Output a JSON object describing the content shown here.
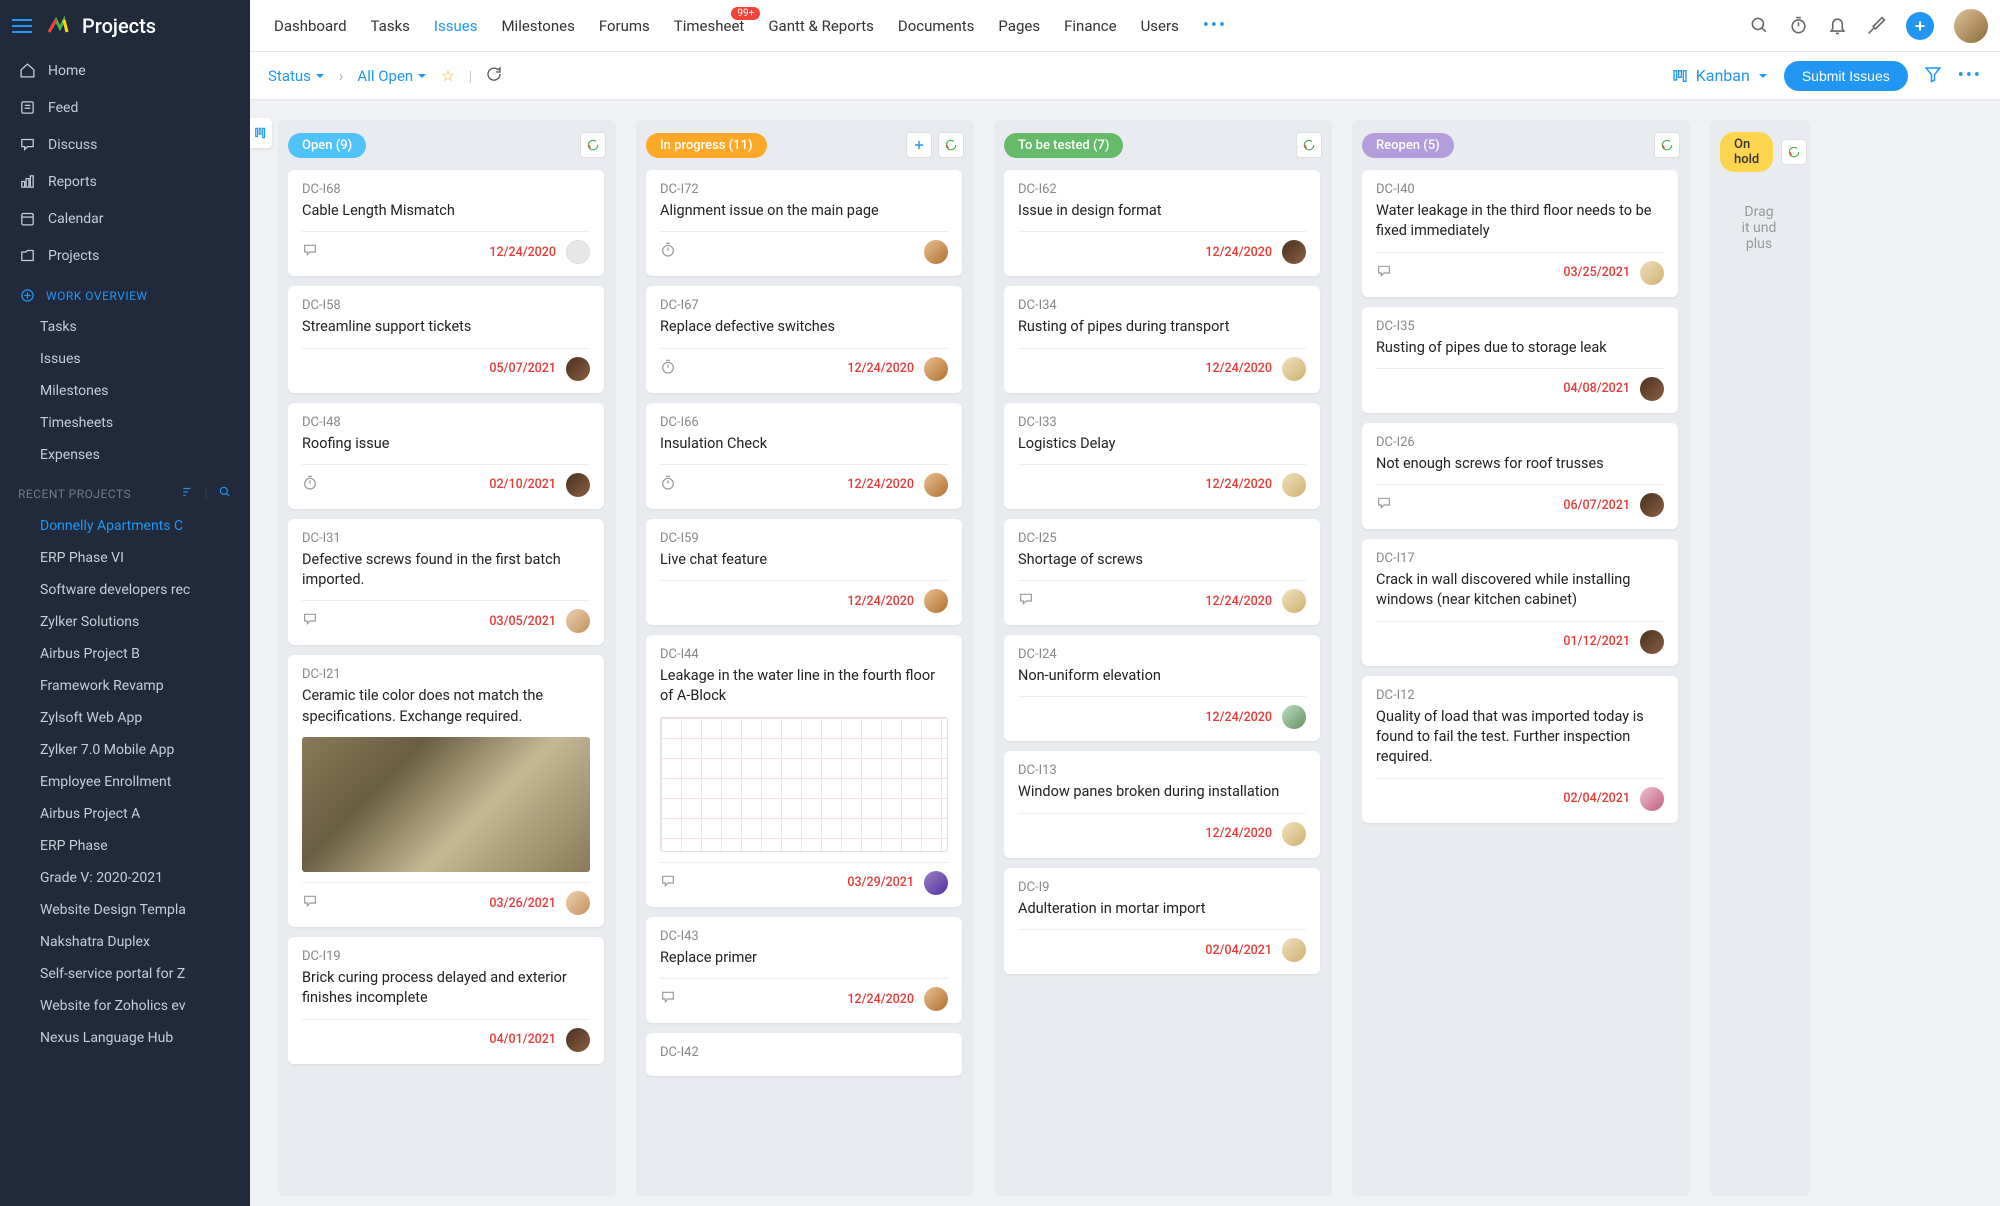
{
  "brand": "Projects",
  "topnav": [
    "Dashboard",
    "Tasks",
    "Issues",
    "Milestones",
    "Forums",
    "Timesheet",
    "Gantt & Reports",
    "Documents",
    "Pages",
    "Finance",
    "Users"
  ],
  "topnav_active_index": 2,
  "timesheet_badge": "99+",
  "sidebar": {
    "main": [
      "Home",
      "Feed",
      "Discuss",
      "Reports",
      "Calendar",
      "Projects"
    ],
    "overview_label": "WORK OVERVIEW",
    "overview": [
      "Tasks",
      "Issues",
      "Milestones",
      "Timesheets",
      "Expenses"
    ],
    "recent_label": "RECENT PROJECTS",
    "recent": [
      "Donnelly Apartments C",
      "ERP Phase VI",
      "Software developers rec",
      "Zylker Solutions",
      "Airbus Project B",
      "Framework Revamp",
      "Zylsoft Web App",
      "Zylker 7.0 Mobile App",
      "Employee Enrollment",
      "Airbus Project A",
      "ERP Phase",
      "Grade V: 2020-2021",
      "Website Design Templa",
      "Nakshatra Duplex",
      "Self-service portal for Z",
      "Website for Zoholics ev",
      "Nexus Language Hub"
    ],
    "recent_active_index": 0
  },
  "subheader": {
    "status": "Status",
    "all_open": "All Open",
    "kanban": "Kanban",
    "submit": "Submit Issues"
  },
  "columns": [
    {
      "label": "Open (9)",
      "pill_class": "pill-open",
      "show_plus": false,
      "cards": [
        {
          "code": "DC-I68",
          "title": "Cable Length Mismatch",
          "date": "12/24/2020",
          "icon": "comment",
          "avatar": "av-empty"
        },
        {
          "code": "DC-I58",
          "title": "Streamline support tickets",
          "date": "05/07/2021",
          "icon": "",
          "avatar": "av1"
        },
        {
          "code": "DC-I48",
          "title": "Roofing issue",
          "date": "02/10/2021",
          "icon": "clock",
          "avatar": "av1"
        },
        {
          "code": "DC-I31",
          "title": "Defective screws found in the first batch imported.",
          "date": "03/05/2021",
          "icon": "comment",
          "avatar": "av2"
        },
        {
          "code": "DC-I21",
          "title": "Ceramic tile color does not match the specifications. Exchange required.",
          "date": "03/26/2021",
          "icon": "comment",
          "avatar": "av2",
          "image": "tile"
        },
        {
          "code": "DC-I19",
          "title": "Brick curing process delayed and exterior finishes incomplete",
          "date": "04/01/2021",
          "icon": "",
          "avatar": "av1"
        }
      ]
    },
    {
      "label": "In progress (11)",
      "pill_class": "pill-inprogress",
      "show_plus": true,
      "cards": [
        {
          "code": "DC-I72",
          "title": "Alignment issue on the main page",
          "date": "",
          "icon": "clock",
          "avatar": "av3"
        },
        {
          "code": "DC-I67",
          "title": "Replace defective switches",
          "date": "12/24/2020",
          "icon": "clock",
          "avatar": "av3"
        },
        {
          "code": "DC-I66",
          "title": "Insulation Check",
          "date": "12/24/2020",
          "icon": "clock",
          "avatar": "av3"
        },
        {
          "code": "DC-I59",
          "title": "Live chat feature",
          "date": "12/24/2020",
          "icon": "",
          "avatar": "av3"
        },
        {
          "code": "DC-I44",
          "title": "Leakage in the water line in the fourth floor of A-Block",
          "date": "03/29/2021",
          "icon": "comment",
          "avatar": "av4",
          "image": "floorplan"
        },
        {
          "code": "DC-I43",
          "title": "Replace primer",
          "date": "12/24/2020",
          "icon": "comment",
          "avatar": "av3"
        },
        {
          "code": "DC-I42",
          "title": "",
          "date": "",
          "icon": "",
          "avatar": ""
        }
      ]
    },
    {
      "label": "To be tested (7)",
      "pill_class": "pill-tobetested",
      "show_plus": false,
      "cards": [
        {
          "code": "DC-I62",
          "title": "Issue in design format",
          "date": "12/24/2020",
          "icon": "",
          "avatar": "av1"
        },
        {
          "code": "DC-I34",
          "title": "Rusting of pipes during transport",
          "date": "12/24/2020",
          "icon": "",
          "avatar": "av5"
        },
        {
          "code": "DC-I33",
          "title": "Logistics Delay",
          "date": "12/24/2020",
          "icon": "",
          "avatar": "av5"
        },
        {
          "code": "DC-I25",
          "title": "Shortage of screws",
          "date": "12/24/2020",
          "icon": "comment",
          "avatar": "av5"
        },
        {
          "code": "DC-I24",
          "title": "Non-uniform elevation",
          "date": "12/24/2020",
          "icon": "",
          "avatar": "av6"
        },
        {
          "code": "DC-I13",
          "title": "Window panes broken during installation",
          "date": "12/24/2020",
          "icon": "",
          "avatar": "av5"
        },
        {
          "code": "DC-I9",
          "title": "Adulteration in mortar import",
          "date": "02/04/2021",
          "icon": "",
          "avatar": "av5"
        }
      ]
    },
    {
      "label": "Reopen (5)",
      "pill_class": "pill-reopen",
      "show_plus": false,
      "cards": [
        {
          "code": "DC-I40",
          "title": "Water leakage in the third floor needs to be fixed immediately",
          "date": "03/25/2021",
          "icon": "comment",
          "avatar": "av5"
        },
        {
          "code": "DC-I35",
          "title": "Rusting of pipes due to storage leak",
          "date": "04/08/2021",
          "icon": "",
          "avatar": "av1"
        },
        {
          "code": "DC-I26",
          "title": "Not enough screws for roof trusses",
          "date": "06/07/2021",
          "icon": "comment",
          "avatar": "av1"
        },
        {
          "code": "DC-I17",
          "title": "Crack in wall discovered while installing windows (near kitchen cabinet)",
          "date": "01/12/2021",
          "icon": "",
          "avatar": "av1"
        },
        {
          "code": "DC-I12",
          "title": "Quality of load that was imported today is found to fail the test. Further inspection required.",
          "date": "02/04/2021",
          "icon": "",
          "avatar": "av7"
        }
      ]
    },
    {
      "label": "On hold",
      "pill_class": "pill-onhold",
      "show_plus": false,
      "cards": [],
      "hint": "Drag it und plus"
    }
  ]
}
